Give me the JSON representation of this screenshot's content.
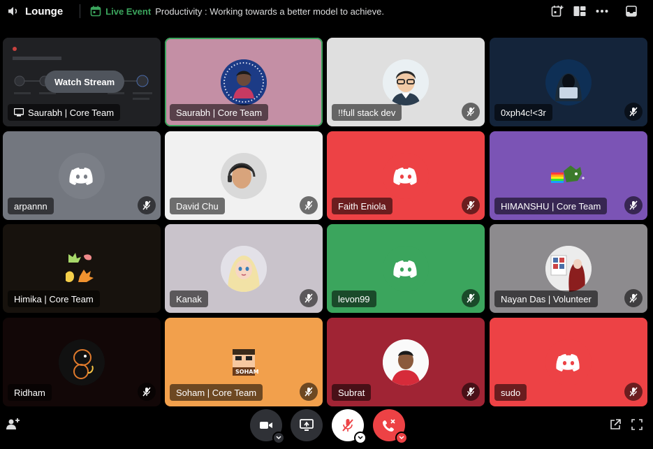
{
  "header": {
    "channel_name": "Lounge",
    "live_label": "Live Event",
    "event_description": "Productivity : Working towards a better model to achieve."
  },
  "stream": {
    "watch_label": "Watch Stream",
    "streamer": "Saurabh | Core Team"
  },
  "participants": [
    {
      "name": "Saurabh | Core Team",
      "muted": false,
      "speaking": true
    },
    {
      "name": "!!full stack dev",
      "muted": true
    },
    {
      "name": "0xph4c!<3r",
      "muted": true
    },
    {
      "name": "arpannn",
      "muted": true
    },
    {
      "name": "David Chu",
      "muted": true
    },
    {
      "name": "Faith Eniola",
      "muted": true
    },
    {
      "name": "HIMANSHU | Core Team",
      "muted": true
    },
    {
      "name": "Himika | Core Team",
      "muted": false
    },
    {
      "name": "Kanak",
      "muted": true
    },
    {
      "name": "levon99",
      "muted": true
    },
    {
      "name": "Nayan Das | Volunteer",
      "muted": true
    },
    {
      "name": "Ridham",
      "muted": true
    },
    {
      "name": "Soham | Core Team",
      "muted": true
    },
    {
      "name": "Subrat",
      "muted": true
    },
    {
      "name": "sudo",
      "muted": true
    }
  ],
  "avatar_text": {
    "soham_badge": "SOHAM"
  },
  "colors": {
    "live_green": "#3ba55d",
    "blurple": "#5865f2",
    "red": "#ed4245",
    "discord_gray": "#747f8d",
    "purple": "#7b54b5"
  },
  "icons": [
    "speaker-icon",
    "live-calendar-icon",
    "add-event-icon",
    "layout-grid-icon",
    "more-icon",
    "inbox-icon",
    "mic-off-icon",
    "monitor-icon",
    "camera-icon",
    "screenshare-icon",
    "hangup-icon",
    "invite-icon",
    "popout-icon",
    "fullscreen-icon"
  ]
}
